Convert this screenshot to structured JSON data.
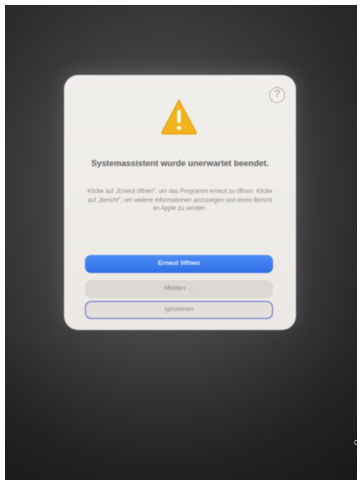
{
  "dialog": {
    "help_label": "?",
    "title": "Systemassistent wurde unerwartet beendet.",
    "message": "Klicke auf „Erneut öffnen\", um das Programm erneut zu öffnen. Klicke auf „Bericht\", um weitere Informationen anzuzeigen und einen Bericht an Apple zu senden.",
    "buttons": {
      "reopen": "Erneut öffnen",
      "report": "Melden …",
      "ignore": "Ignorieren"
    }
  },
  "colors": {
    "primary_button": "#2f6fe6",
    "warning_icon": "#f2b21c",
    "focus_ring": "#6b72cf"
  },
  "icons": {
    "warning": "warning-triangle-icon",
    "help": "help-icon"
  },
  "edge_glyph": "c"
}
